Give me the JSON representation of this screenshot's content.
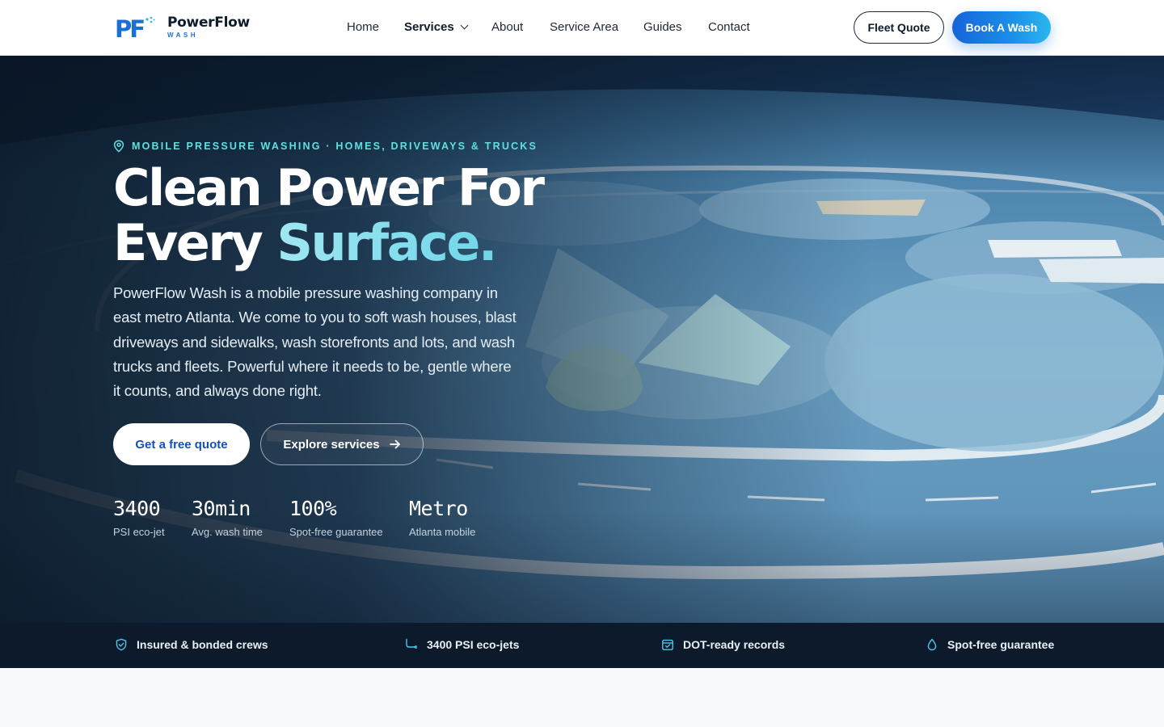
{
  "brand": {
    "name": "PowerFlow",
    "sub": "WASH",
    "mark": "PF"
  },
  "nav": {
    "links": [
      {
        "label": "Home"
      },
      {
        "label": "Services"
      },
      {
        "label": "About"
      },
      {
        "label": "Service Area"
      },
      {
        "label": "Guides"
      },
      {
        "label": "Contact"
      }
    ],
    "fleet_quote": "Fleet Quote",
    "book_wash": "Book A Wash"
  },
  "hero": {
    "eyebrow": "MOBILE PRESSURE WASHING · HOMES, DRIVEWAYS & TRUCKS",
    "headline_line1": "Clean Power For",
    "headline_line2a": "Every ",
    "headline_line2b": "Surface.",
    "lead": "PowerFlow Wash is a mobile pressure washing company in east metro Atlanta. We come to you to soft wash houses, blast driveways and sidewalks, wash storefronts and lots, and wash trucks and fleets. Powerful where it needs to be, gentle where it counts, and always done right.",
    "cta_primary": "Get a free quote",
    "cta_secondary": "Explore services",
    "stats": [
      {
        "value": "3400",
        "label": "PSI eco-jet"
      },
      {
        "value": "30min",
        "label": "Avg. wash time"
      },
      {
        "value": "100%",
        "label": "Spot-free guarantee"
      },
      {
        "value": "Metro",
        "label": "Atlanta mobile"
      }
    ]
  },
  "trust": [
    {
      "icon": "shield-check-icon",
      "label": "Insured & bonded crews"
    },
    {
      "icon": "spray-wand-icon",
      "label": "3400 PSI eco-jets"
    },
    {
      "icon": "calendar-check-icon",
      "label": "DOT-ready records"
    },
    {
      "icon": "water-drop-icon",
      "label": "Spot-free guarantee"
    }
  ],
  "colors": {
    "brand_blue": "#1664d9",
    "accent_cyan": "#5ee0e0",
    "nav_bg": "#ffffff",
    "trust_bg": "#0c1a2c"
  }
}
